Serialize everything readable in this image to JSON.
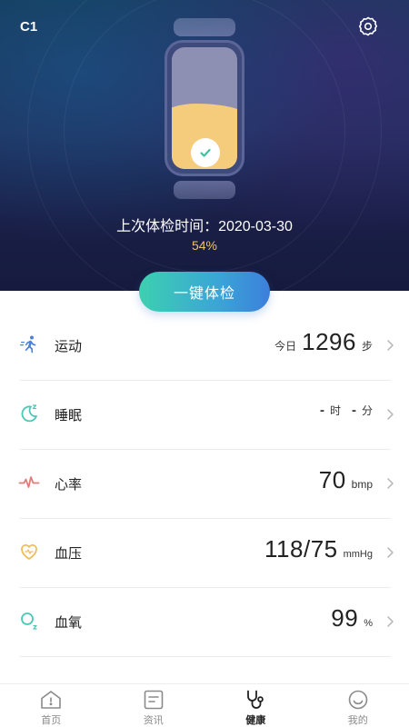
{
  "header": {
    "device_name": "C1",
    "last_check_label": "上次体检时间：2020-03-30",
    "battery_percent": "54%",
    "battery_level": 0.54
  },
  "check_button": {
    "label": "一键体检"
  },
  "metrics": [
    {
      "name": "运动",
      "prefix": "今日",
      "value": "1296",
      "unit": "步"
    },
    {
      "name": "睡眠",
      "value1": "-",
      "unit1": "时",
      "value2": "-",
      "unit2": "分"
    },
    {
      "name": "心率",
      "value": "70",
      "unit": "bmp"
    },
    {
      "name": "血压",
      "value": "118/75",
      "unit": "mmHg"
    },
    {
      "name": "血氧",
      "value": "99",
      "unit": "%"
    }
  ],
  "tabs": [
    {
      "label": "首页",
      "icon": "home-icon"
    },
    {
      "label": "资讯",
      "icon": "news-icon"
    },
    {
      "label": "健康",
      "icon": "stethoscope-icon",
      "active": true
    },
    {
      "label": "我的",
      "icon": "smile-icon"
    }
  ],
  "colors": {
    "accent_gradient_start": "#3dd0b0",
    "accent_gradient_end": "#3c7fdc",
    "battery_text": "#f1c26d",
    "band_fill": "#f4cc7c"
  }
}
